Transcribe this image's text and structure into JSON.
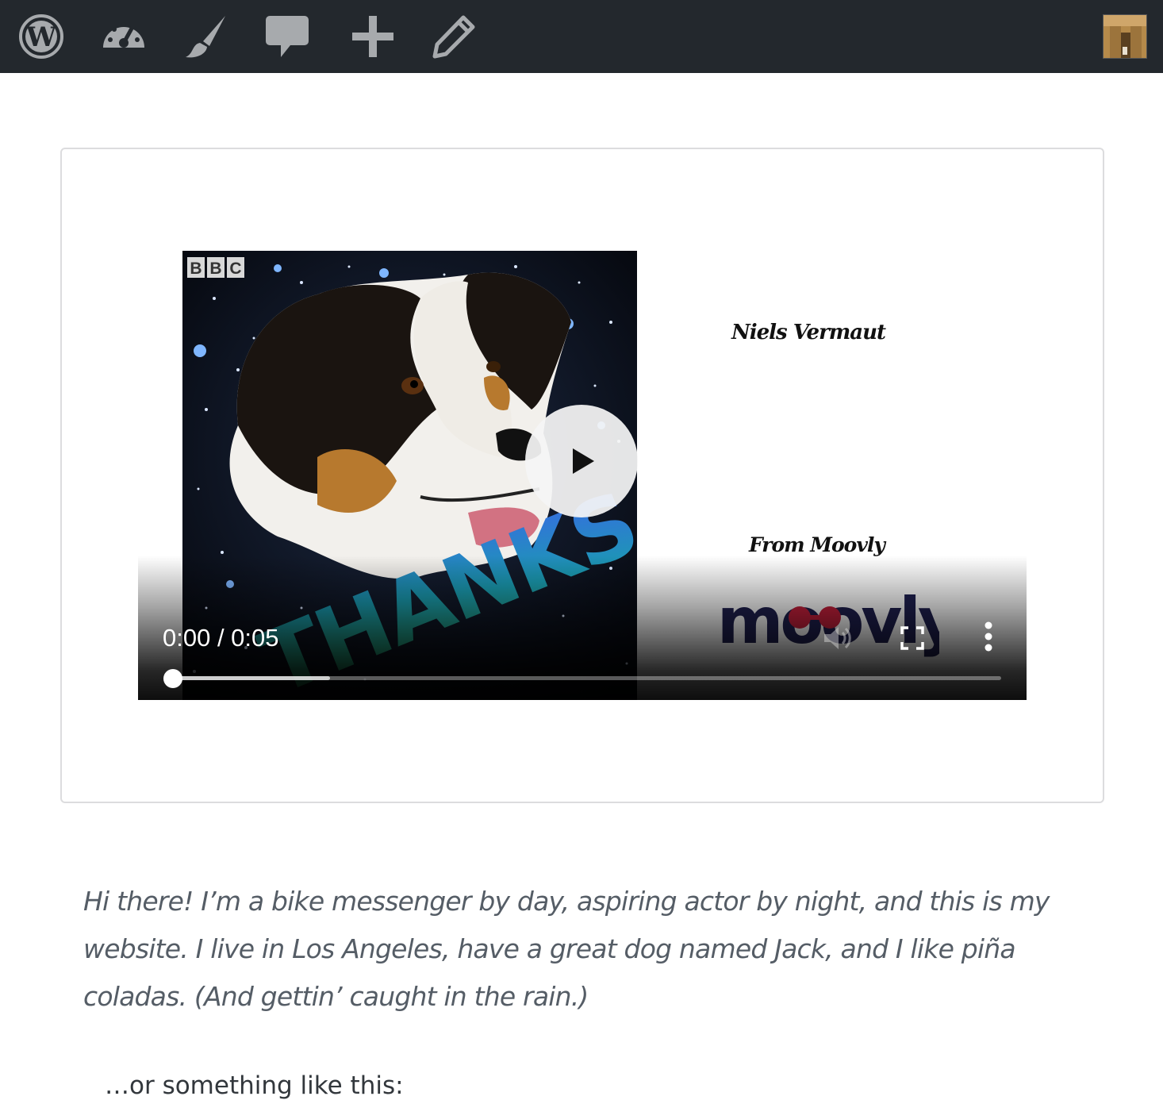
{
  "admin_bar": {
    "items": [
      {
        "name": "wordpress-logo-icon"
      },
      {
        "name": "dashboard-icon"
      },
      {
        "name": "customize-icon"
      },
      {
        "name": "comments-icon"
      },
      {
        "name": "new-content-icon"
      },
      {
        "name": "edit-icon"
      }
    ],
    "avatar": {
      "name": "user-avatar"
    },
    "background": "#23282d",
    "icon_color": "#a7aaad"
  },
  "video": {
    "thumbnail": {
      "watermark": "BBC",
      "caption": "THANKS"
    },
    "credits": {
      "name": "Niels Vermaut",
      "from": "From Moovly"
    },
    "brand_logo": "moovly",
    "player": {
      "time_display": "0:00 / 0:05",
      "current_time": "0:00",
      "duration": "0:05",
      "played_fraction": 0,
      "buffered_fraction": 0.19,
      "play_icon": "play-icon",
      "mute_icon": "volume-icon",
      "fullscreen_icon": "fullscreen-icon",
      "menu_icon": "more-vertical-icon"
    }
  },
  "content": {
    "intro": "Hi there! I’m a bike messenger by day, aspiring actor by night, and this is my website. I live in Los Angeles, have a great dog named Jack, and I like piña coladas. (And gettin’ caught in the rain.)",
    "after": "…or something like this:"
  }
}
